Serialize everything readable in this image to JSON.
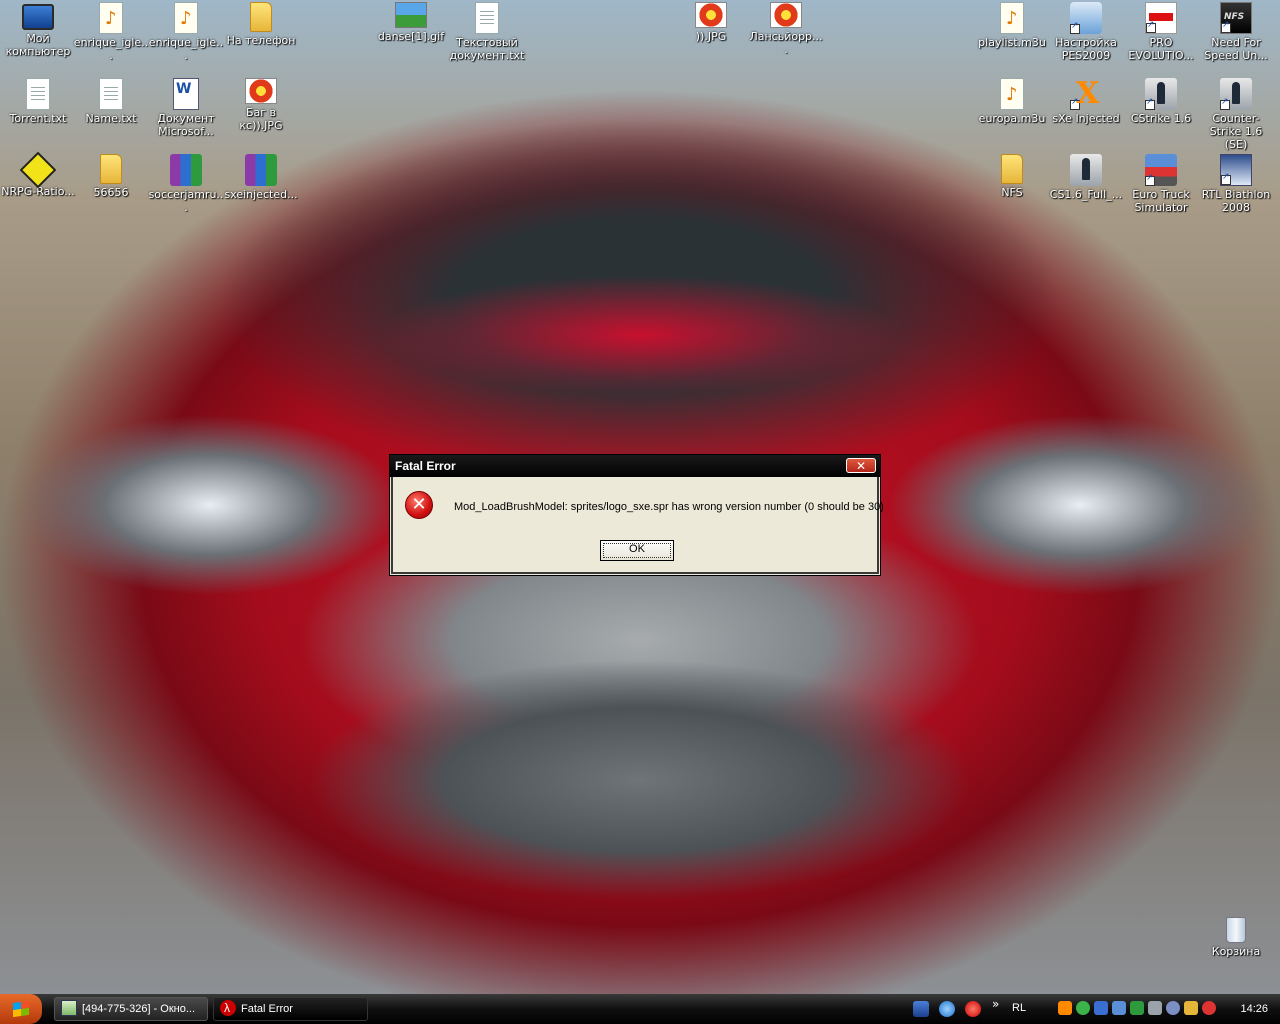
{
  "desktop": {
    "icons": [
      {
        "label": "Мой компьютер"
      },
      {
        "label": "enrique_igle..."
      },
      {
        "label": "enrique_igle..."
      },
      {
        "label": "На телефон"
      },
      {
        "label": "danse[1].gif"
      },
      {
        "label": "Текстовый документ.txt"
      },
      {
        "label": ")).JPG"
      },
      {
        "label": "Лансьйорр...."
      },
      {
        "label": "playlist.m3u"
      },
      {
        "label": "Настройка PES2009"
      },
      {
        "label": "PRO EVOLUTIO..."
      },
      {
        "label": "Need For Speed Un..."
      },
      {
        "label": "Torrent.txt"
      },
      {
        "label": "Name.txt"
      },
      {
        "label": "Документ Microsof..."
      },
      {
        "label": "Баг в кс)).JPG"
      },
      {
        "label": "europa.m3u"
      },
      {
        "label": "sXe Injected"
      },
      {
        "label": "CStrike 1.6"
      },
      {
        "label": "Counter-Strike 1.6 (SE)"
      },
      {
        "label": "NRPG-Ratio..."
      },
      {
        "label": "56656"
      },
      {
        "label": "soccerjamru..."
      },
      {
        "label": "sxeinjected..."
      },
      {
        "label": "NFS"
      },
      {
        "label": "CS1.6_Full_..."
      },
      {
        "label": "Euro Truck Simulator"
      },
      {
        "label": "RTL Biathlon 2008"
      },
      {
        "label": "Корзина"
      }
    ]
  },
  "dialog": {
    "title": "Fatal Error",
    "close_glyph": "✕",
    "error_glyph": "✕",
    "message": "Mod_LoadBrushModel: sprites/logo_sxe.spr has wrong version number (0 should be 30)",
    "ok_label": "OK"
  },
  "taskbar": {
    "tasks": [
      {
        "label": "[494-775-326] - Окно..."
      },
      {
        "label": "Fatal Error"
      }
    ],
    "chevron": "»",
    "language": "RL",
    "clock": "14:26"
  }
}
